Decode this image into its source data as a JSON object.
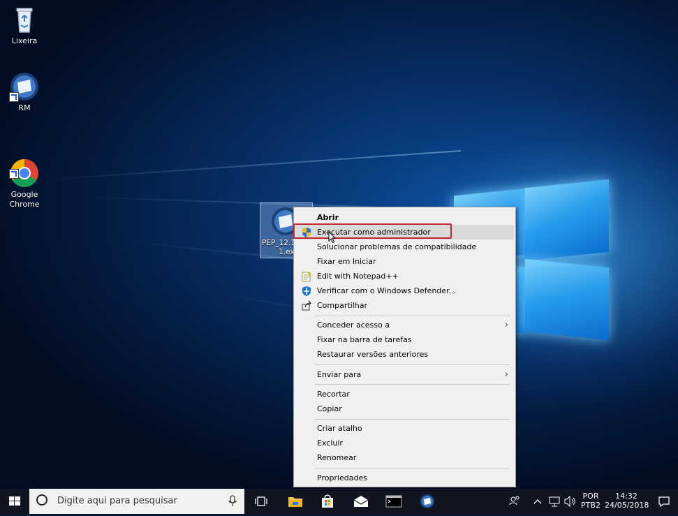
{
  "desktop": {
    "icons": [
      {
        "label": "Lixeira",
        "icon": "recycle-bin-icon"
      },
      {
        "label": "RM",
        "icon": "rm-app-icon"
      },
      {
        "label": "Google\nChrome",
        "icon": "chrome-icon"
      }
    ],
    "selected_file": {
      "label_line1": "PEP_12.1",
      "label_line2": "1.exe",
      "icon": "rm-app-icon"
    }
  },
  "context_menu": {
    "items": [
      {
        "label": "Abrir",
        "bold": true
      },
      {
        "label": "Executar como administrador",
        "icon": "uac-shield-icon"
      },
      {
        "label": "Solucionar problemas de compatibilidade"
      },
      {
        "label": "Fixar em Iniciar"
      },
      {
        "label": "Edit with Notepad++",
        "icon": "notepad-plus-plus-icon"
      },
      {
        "label": "Verificar com o Windows Defender...",
        "icon": "windows-defender-icon"
      },
      {
        "label": "Compartilhar",
        "icon": "share-icon"
      },
      {
        "label": "Conceder acesso a",
        "submenu": true
      },
      {
        "label": "Fixar na barra de tarefas"
      },
      {
        "label": "Restaurar versões anteriores"
      },
      {
        "label": "Enviar para",
        "submenu": true
      },
      {
        "label": "Recortar"
      },
      {
        "label": "Copiar"
      },
      {
        "label": "Criar atalho"
      },
      {
        "label": "Excluir"
      },
      {
        "label": "Renomear"
      },
      {
        "label": "Propriedades"
      }
    ],
    "highlighted": "Executar como administrador",
    "annotation_color": "#c4262b"
  },
  "taskbar": {
    "search_placeholder": "Digite aqui para pesquisar",
    "pinned": [
      "task-view-icon",
      "file-explorer-icon",
      "store-icon",
      "mail-icon",
      "cmd-icon",
      "rm-app-icon"
    ],
    "tray": {
      "language_line1": "POR",
      "language_line2": "PTB2",
      "time": "14:32",
      "date": "24/05/2018"
    }
  },
  "colors": {
    "taskbar": "#111521",
    "menu_bg": "#f0f0f0",
    "accent": "#0078d7"
  }
}
